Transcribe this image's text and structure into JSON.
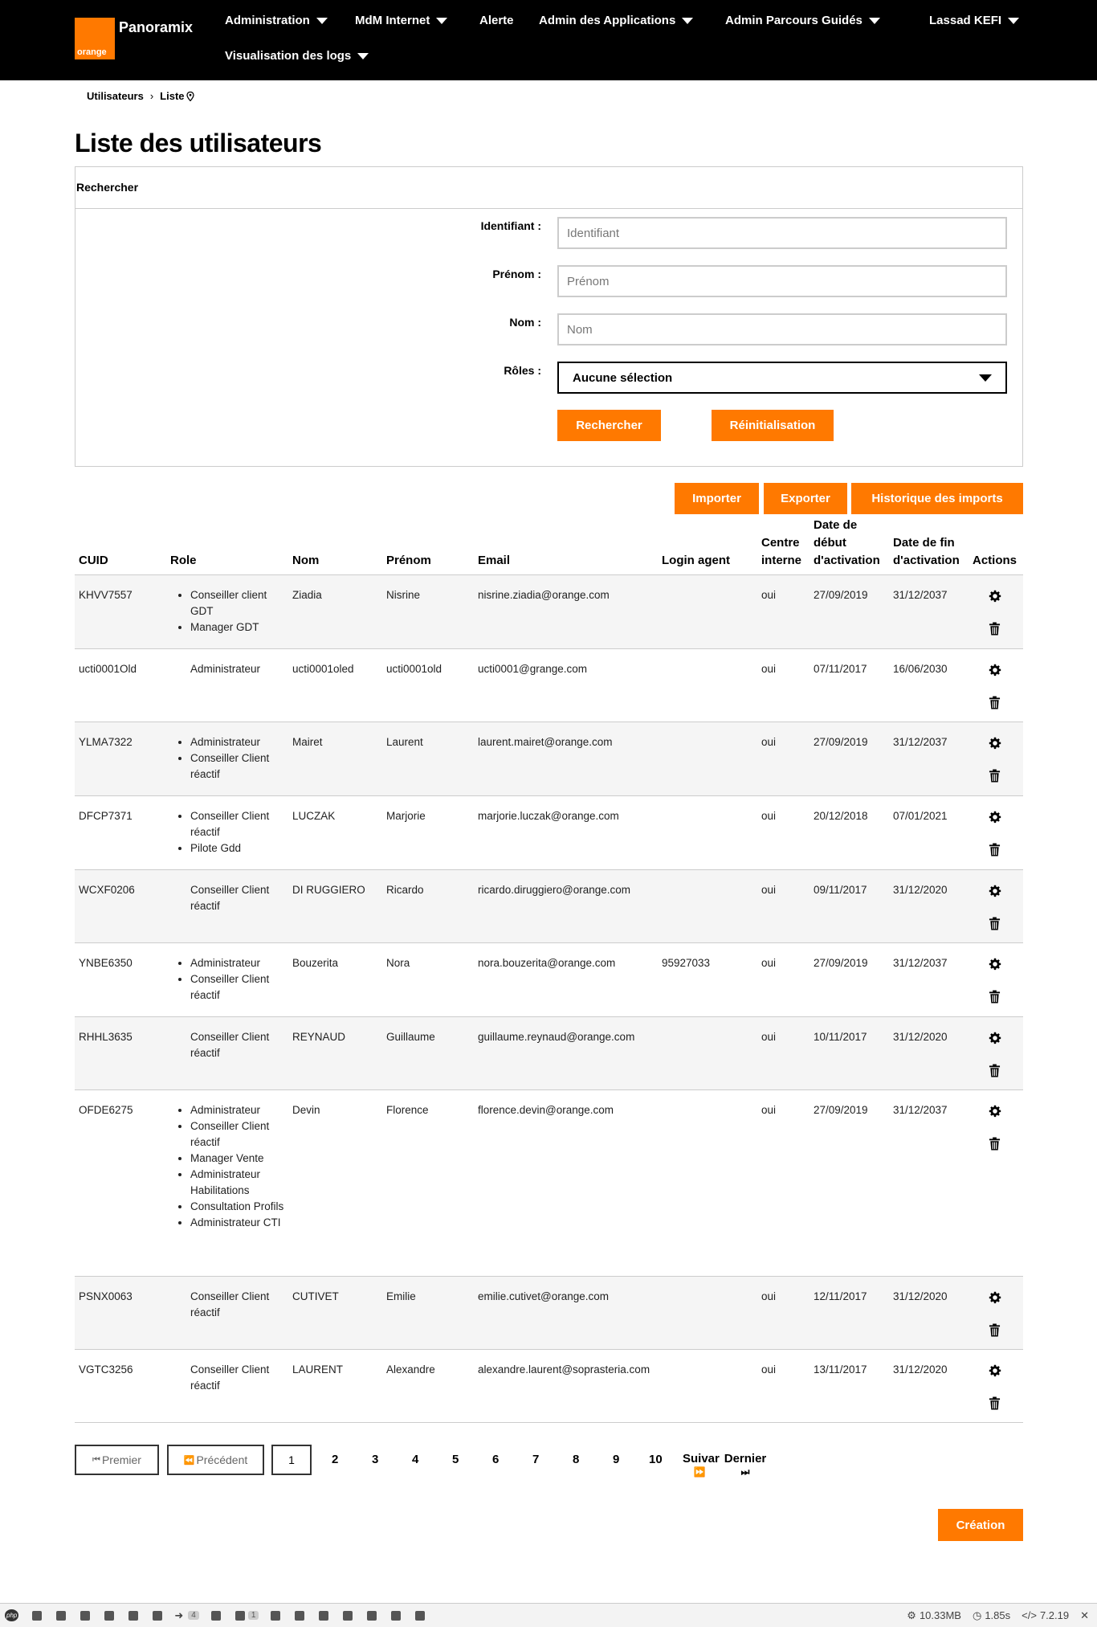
{
  "nav": {
    "logo_text": "orange",
    "brand": "Panoramix",
    "items": [
      "Administration",
      "MdM Internet",
      "Alerte",
      "Admin des Applications",
      "Admin Parcours Guidés",
      "Visualisation des logs"
    ],
    "user": "Lassad KEFI"
  },
  "breadcrumb": {
    "parent": "Utilisateurs",
    "current": "Liste"
  },
  "page_title": "Liste des utilisateurs",
  "search": {
    "header": "Rechercher",
    "identifiant_label": "Identifiant :",
    "identifiant_placeholder": "Identifiant",
    "prenom_label": "Prénom :",
    "prenom_placeholder": "Prénom",
    "nom_label": "Nom :",
    "nom_placeholder": "Nom",
    "roles_label": "Rôles :",
    "roles_value": "Aucune sélection",
    "search_button": "Rechercher",
    "reset_button": "Réinitialisation"
  },
  "toolbar": {
    "import": "Importer",
    "export": "Exporter",
    "history": "Historique des imports"
  },
  "table": {
    "headers": [
      "CUID",
      "Role",
      "Nom",
      "Prénom",
      "Email",
      "Login agent",
      "Centre interne",
      "Date de début d'activation",
      "Date de fin d'activation",
      "Actions"
    ],
    "rows": [
      {
        "cuid": "KHVV7557",
        "roles": [
          "Conseiller client GDT",
          "Manager GDT"
        ],
        "list": true,
        "nom": "Ziadia",
        "prenom": "Nisrine",
        "email": "nisrine.ziadia@orange.com",
        "login": "",
        "centre": "oui",
        "debut": "27/09/2019",
        "fin": "31/12/2037"
      },
      {
        "cuid": "ucti0001Old",
        "roles": [
          "Administrateur"
        ],
        "list": false,
        "nom": "ucti0001oled",
        "prenom": "ucti0001old",
        "email": "ucti0001@grange.com",
        "login": "",
        "centre": "oui",
        "debut": "07/11/2017",
        "fin": "16/06/2030"
      },
      {
        "cuid": "YLMA7322",
        "roles": [
          "Administrateur",
          "Conseiller Client réactif"
        ],
        "list": true,
        "nom": "Mairet",
        "prenom": "Laurent",
        "email": "laurent.mairet@orange.com",
        "login": "",
        "centre": "oui",
        "debut": "27/09/2019",
        "fin": "31/12/2037"
      },
      {
        "cuid": "DFCP7371",
        "roles": [
          "Conseiller Client réactif",
          "Pilote Gdd"
        ],
        "list": true,
        "nom": "LUCZAK",
        "prenom": "Marjorie",
        "email": "marjorie.luczak@orange.com",
        "login": "",
        "centre": "oui",
        "debut": "20/12/2018",
        "fin": "07/01/2021"
      },
      {
        "cuid": "WCXF0206",
        "roles": [
          "Conseiller Client réactif"
        ],
        "list": false,
        "nom": "DI RUGGIERO",
        "prenom": "Ricardo",
        "email": "ricardo.diruggiero@orange.com",
        "login": "",
        "centre": "oui",
        "debut": "09/11/2017",
        "fin": "31/12/2020"
      },
      {
        "cuid": "YNBE6350",
        "roles": [
          "Administrateur",
          "Conseiller Client réactif"
        ],
        "list": true,
        "nom": "Bouzerita",
        "prenom": "Nora",
        "email": "nora.bouzerita@orange.com",
        "login": "95927033",
        "centre": "oui",
        "debut": "27/09/2019",
        "fin": "31/12/2037"
      },
      {
        "cuid": "RHHL3635",
        "roles": [
          "Conseiller Client réactif"
        ],
        "list": false,
        "nom": "REYNAUD",
        "prenom": "Guillaume",
        "email": "guillaume.reynaud@orange.com",
        "login": "",
        "centre": "oui",
        "debut": "10/11/2017",
        "fin": "31/12/2020"
      },
      {
        "cuid": "OFDE6275",
        "roles": [
          "Administrateur",
          "Conseiller Client réactif",
          "Manager Vente",
          "Administrateur Habilitations",
          "Consultation Profils",
          "Administrateur CTI"
        ],
        "list": true,
        "nom": "Devin",
        "prenom": "Florence",
        "email": "florence.devin@orange.com",
        "login": "",
        "centre": "oui",
        "debut": "27/09/2019",
        "fin": "31/12/2037"
      },
      {
        "cuid": "PSNX0063",
        "roles": [
          "Conseiller Client réactif"
        ],
        "list": false,
        "nom": "CUTIVET",
        "prenom": "Emilie",
        "email": "emilie.cutivet@orange.com",
        "login": "",
        "centre": "oui",
        "debut": "12/11/2017",
        "fin": "31/12/2020"
      },
      {
        "cuid": "VGTC3256",
        "roles": [
          "Conseiller Client réactif"
        ],
        "list": false,
        "nom": "LAURENT",
        "prenom": "Alexandre",
        "email": "alexandre.laurent@soprasteria.com",
        "login": "",
        "centre": "oui",
        "debut": "13/11/2017",
        "fin": "31/12/2020"
      }
    ]
  },
  "pagination": {
    "first": "Premier",
    "prev": "Précédent",
    "pages": [
      "1",
      "2",
      "3",
      "4",
      "5",
      "6",
      "7",
      "8",
      "9",
      "10"
    ],
    "current": "1",
    "next": "Suivar",
    "last": "Dernier"
  },
  "create_button": "Création",
  "debugbar": {
    "php_label": "php",
    "badge1": "4",
    "badge2": "1",
    "memory": "10.33MB",
    "time": "1.85s",
    "version": "7.2.19"
  },
  "colors": {
    "accent": "#ff7900",
    "nav_bg": "#000000",
    "row_alt": "#f5f5f5"
  }
}
